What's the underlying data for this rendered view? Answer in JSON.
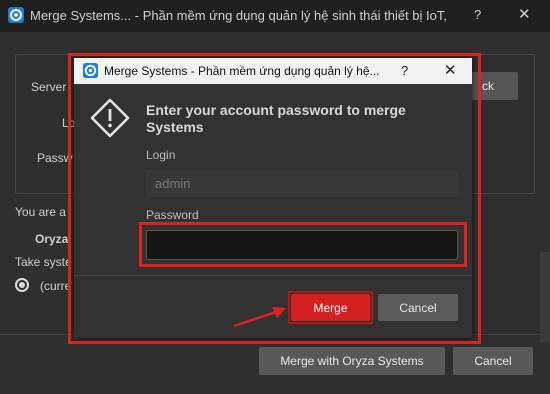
{
  "outer_window": {
    "title": "Merge Systems... - Phần mềm ứng dụng quản lý hệ sinh thái thiết bị IoT, camer...",
    "help": "?",
    "close": "✕",
    "labels": {
      "server": "Server",
      "login": "Lo",
      "password": "Passw",
      "you_are": "You are a",
      "oryza": "Oryza",
      "take_system": "Take syste",
      "current": "(curre"
    },
    "check_button": "ck",
    "merge_button": "Merge with Oryza Systems",
    "cancel_button": "Cancel"
  },
  "dialog": {
    "title": "Merge Systems - Phần mềm ứng dụng quản lý hệ...",
    "help": "?",
    "close": "✕",
    "heading": "Enter your account password to merge Systems",
    "login_label": "Login",
    "login_value": "admin",
    "password_label": "Password",
    "password_value": "",
    "merge_button": "Merge",
    "cancel_button": "Cancel"
  },
  "colors": {
    "highlight": "#e02020",
    "merge": "#d42020"
  },
  "icons": {
    "app": "oryza-app-icon",
    "warning": "warning-diamond-icon",
    "arrow": "red-arrow-annotation"
  }
}
